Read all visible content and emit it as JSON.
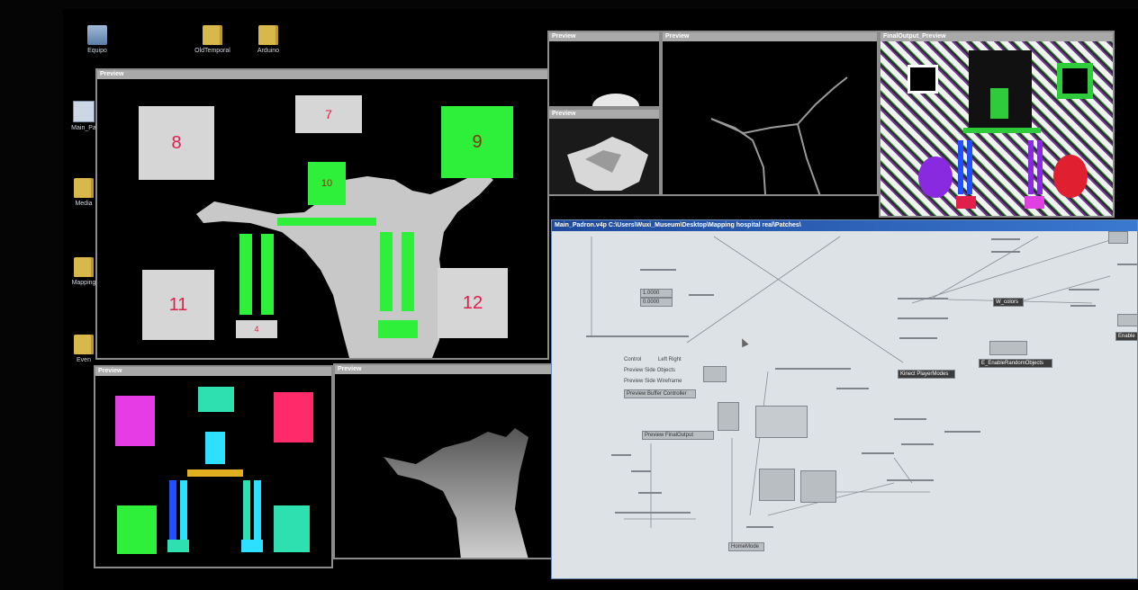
{
  "desktop": {
    "icons": [
      {
        "label": "Equipo"
      },
      {
        "label": "OldTemporal"
      },
      {
        "label": "Arduino"
      },
      {
        "label": "Main_Pa"
      },
      {
        "label": "Media"
      },
      {
        "label": "Mapping"
      },
      {
        "label": "Even"
      }
    ]
  },
  "windows": {
    "main_preview": {
      "title": "Preview",
      "squares": [
        "8",
        "7",
        "9",
        "10",
        "11",
        "4",
        "12"
      ]
    },
    "small_preview_1": {
      "title": "Preview"
    },
    "small_preview_2": {
      "title": "Preview"
    },
    "silhouette_preview": {
      "title": "Preview"
    },
    "final_output": {
      "title": "FinalOutput_Preview"
    },
    "bottom_left_preview": {
      "title": "Preview"
    },
    "depth_preview": {
      "title": "Preview"
    }
  },
  "patch_editor": {
    "title": "Main_Padron.v4p   C:\\Users\\Wuxi_Museum\\Desktop\\Mapping hospital real\\Patches\\",
    "nodes": [
      {
        "text": "Kinect PlayerModes"
      },
      {
        "text": "E_EnableRandomObjects"
      },
      {
        "text": "W_colors"
      },
      {
        "text": "Enable"
      },
      {
        "text": "Control"
      },
      {
        "text": "Left Right"
      },
      {
        "text": "Preview Side Objects"
      },
      {
        "text": "Preview Side Wireframe"
      },
      {
        "text": "Preview Buffer Controller"
      },
      {
        "text": "Preview  FinalOutput"
      },
      {
        "text": "HomeMode"
      },
      {
        "text": "1.0000"
      },
      {
        "text": "0.0000"
      }
    ]
  },
  "colors": {
    "accent_green": "#2ef03a",
    "label_red": "#e01e4a",
    "titlebar_blue": "#1f4a9c",
    "magenta": "#e63ce6",
    "pink": "#ff2a6a",
    "teal": "#2ee0b0",
    "cyan": "#2ee0ff",
    "yellow": "#e0b020",
    "blue": "#2050ff",
    "purple": "#8a2ae0",
    "red": "#e02030"
  }
}
